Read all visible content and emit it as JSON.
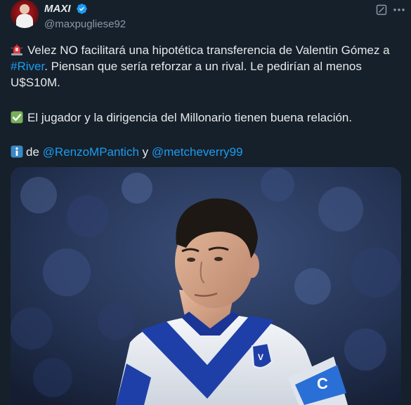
{
  "author": {
    "display_name": "MAXI",
    "handle": "@maxpugliese92"
  },
  "icons": {
    "avatar": "profile-photo",
    "verified": "verified-badge-icon",
    "grok": "grok-icon",
    "more": "more-options-icon",
    "siren": "police-light-emoji",
    "check": "white-check-mark-emoji",
    "info": "information-emoji"
  },
  "tweet": {
    "p1": {
      "before": "Velez NO facilitará una hipotética transferencia de Valentin Gómez a",
      "hashtag": "#River",
      "after": ".  Piensan que sería reforzar a un rival. Le pedirían al menos U$S10M."
    },
    "p2": "El jugador y la dirigencia del Millonario tienen buena relación.",
    "p3": {
      "prefix": "de",
      "mention1": "@RenzoMPantich",
      "conj": "y",
      "mention2": "@metcheverry99"
    }
  },
  "colors": {
    "background": "#15202b",
    "text": "#e7e9ea",
    "secondary": "#8b98a5",
    "link": "#1d9bf0",
    "verified": "#1d9bf0"
  }
}
